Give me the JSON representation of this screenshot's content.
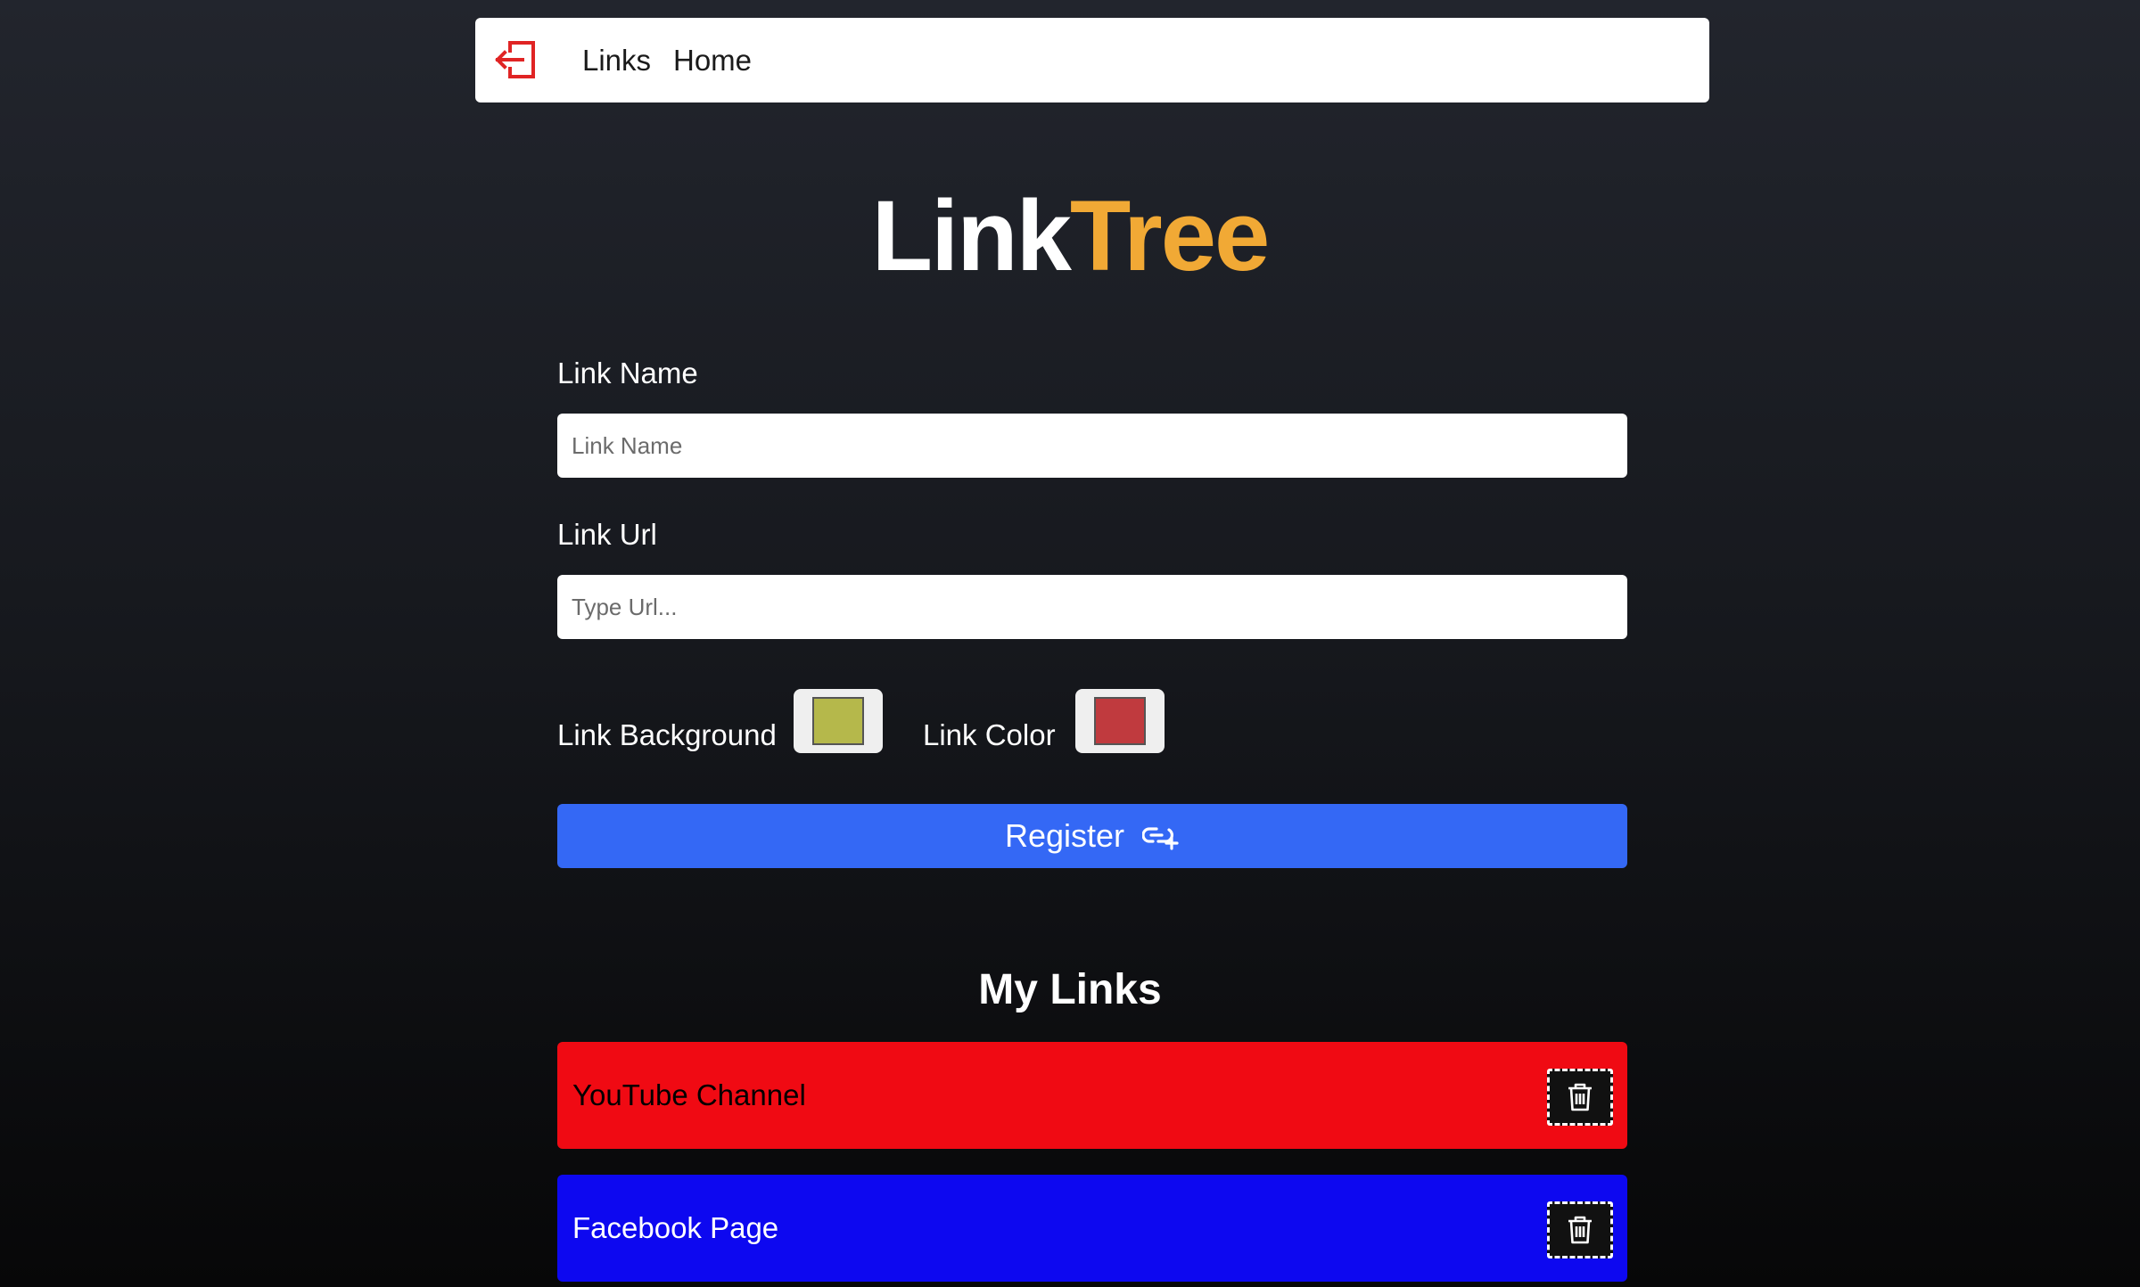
{
  "nav": {
    "logout_icon": "logout-icon",
    "links_label": "Links",
    "home_label": "Home"
  },
  "logo": {
    "part1": "Link",
    "part2": "Tree",
    "accent_color": "#f1a935"
  },
  "form": {
    "name_label": "Link Name",
    "name_placeholder": "Link Name",
    "name_value": "",
    "url_label": "Link Url",
    "url_placeholder": "Type Url...",
    "url_value": "",
    "bg_label": "Link Background",
    "bg_value": "#b5b84b",
    "color_label": "Link Color",
    "color_value": "#c03a3e",
    "register_label": "Register",
    "register_icon": "link-add-icon",
    "register_color": "#3468f5"
  },
  "links_section": {
    "title": "My Links",
    "items": [
      {
        "name": "YouTube Channel",
        "bg": "#f00a13",
        "color": "#000000",
        "delete_icon": "trash-icon"
      },
      {
        "name": "Facebook Page",
        "bg": "#0d08f0",
        "color": "#ffffff",
        "delete_icon": "trash-icon"
      }
    ]
  }
}
